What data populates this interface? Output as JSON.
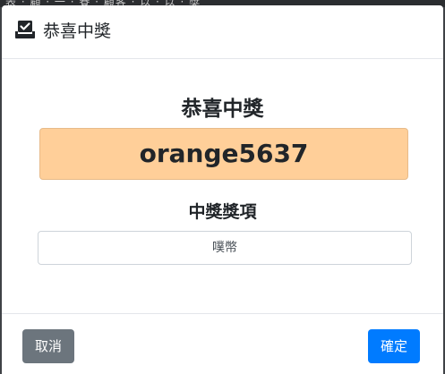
{
  "backdrop": {
    "text": "表 · 顧 · 一 · 賽 · 顧客 · 以 · 以 · 獎"
  },
  "modal": {
    "title": "恭喜中獎",
    "icon": "checkbox-tray-icon"
  },
  "body": {
    "heading": "恭喜中獎",
    "winner": "orange5637",
    "prize_label": "中獎獎項",
    "prize_value": "噗幣"
  },
  "footer": {
    "cancel_label": "取消",
    "confirm_label": "確定"
  },
  "colors": {
    "winner_bg": "#ffcf99",
    "cancel_bg": "#6c757d",
    "confirm_bg": "#007bff"
  }
}
